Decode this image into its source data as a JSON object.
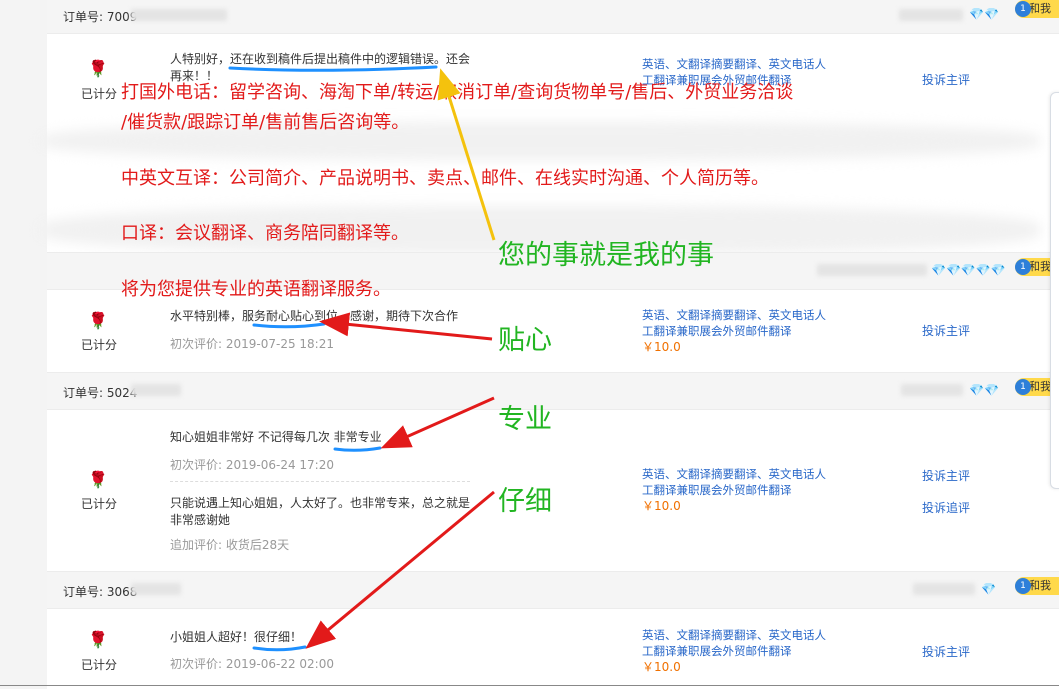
{
  "labels": {
    "scored": "已计分",
    "product_line1": "英语、文翻译摘要翻译、英文电话人",
    "product_line2": "工翻译兼职展会外贸邮件翻译",
    "price": "￥10.0",
    "complain": "投诉主评",
    "complain_followup": "投诉追评",
    "chat_badge": "和我",
    "chat_count": "1"
  },
  "orders": [
    {
      "order_no": "订单号: 7009"
    },
    {
      "order_no": ""
    },
    {
      "order_no": "订单号: 5024"
    },
    {
      "order_no": "订单号: 3068"
    }
  ],
  "reviews": {
    "r1": {
      "text": "人特别好，还在收到稿件后提出稿件中的逻辑错误。还会再来！！"
    },
    "r2": {
      "text": "水平特别棒，服务耐心贴心到位，感谢，期待下次合作",
      "date": "初次评价: 2019-07-25 18:21"
    },
    "r3": {
      "text": "知心姐姐非常好 不记得每几次 非常专业",
      "date": "初次评价: 2019-06-24 17:20",
      "followup": "只能说遇上知心姐姐，人太好了。也非常专来，总之就是非常感谢她",
      "followup_date": "追加评价: 收货后28天"
    },
    "r4": {
      "text": "小姐姐人超好！很仔细！",
      "date": "初次评价: 2019-06-22 02:00"
    }
  },
  "overlay": {
    "red_lines": [
      "打国外电话：留学咨询、海淘下单/转运/取消订单/查询货物单号/售后、外贸业务洽谈",
      "/催货款/跟踪订单/售前售后咨询等。",
      "中英文互译：公司简介、产品说明书、卖点、邮件、在线实时沟通、个人简历等。",
      "口译：会议翻译、商务陪同翻译等。",
      "将为您提供专业的英语翻译服务。"
    ],
    "green": {
      "slogan": "您的事就是我的事",
      "caring": "贴心",
      "professional": "专业",
      "careful": "仔细"
    }
  },
  "colors": {
    "overlay_red": "#e21a1a",
    "overlay_green": "#22b522",
    "link_blue": "#2a68c9",
    "price_orange": "#f07000",
    "arrow_yellow": "#f4c20d",
    "underline_blue": "#1e90ff"
  },
  "icons": {
    "rating": "rose-icon",
    "credit": "diamond-icon",
    "chat": "chat-bubble-icon"
  }
}
